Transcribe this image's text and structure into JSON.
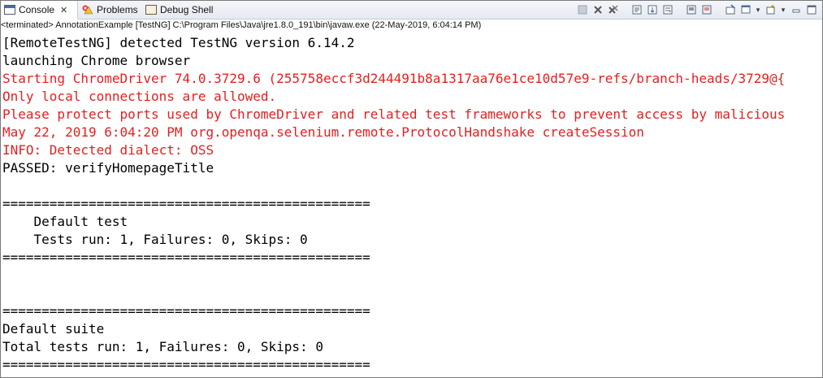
{
  "tabs": [
    {
      "label": "Console",
      "close": "✕"
    },
    {
      "label": "Problems"
    },
    {
      "label": "Debug Shell"
    }
  ],
  "status_line": "<terminated> AnnotationExample [TestNG] C:\\Program Files\\Java\\jre1.8.0_191\\bin\\javaw.exe (22-May-2019, 6:04:14 PM)",
  "console_lines": [
    {
      "text": "[RemoteTestNG] detected TestNG version 6.14.2",
      "color": "black"
    },
    {
      "text": "launching Chrome browser",
      "color": "black"
    },
    {
      "text": "Starting ChromeDriver 74.0.3729.6 (255758eccf3d244491b8a1317aa76e1ce10d57e9-refs/branch-heads/3729@{",
      "color": "red"
    },
    {
      "text": "Only local connections are allowed.",
      "color": "red"
    },
    {
      "text": "Please protect ports used by ChromeDriver and related test frameworks to prevent access by malicious",
      "color": "red"
    },
    {
      "text": "May 22, 2019 6:04:20 PM org.openqa.selenium.remote.ProtocolHandshake createSession",
      "color": "red"
    },
    {
      "text": "INFO: Detected dialect: OSS",
      "color": "red"
    },
    {
      "text": "PASSED: verifyHomepageTitle",
      "color": "black"
    },
    {
      "text": "",
      "color": "black"
    },
    {
      "text": "===============================================",
      "color": "black"
    },
    {
      "text": "    Default test",
      "color": "black"
    },
    {
      "text": "    Tests run: 1, Failures: 0, Skips: 0",
      "color": "black"
    },
    {
      "text": "===============================================",
      "color": "black"
    },
    {
      "text": "",
      "color": "black"
    },
    {
      "text": "",
      "color": "black"
    },
    {
      "text": "===============================================",
      "color": "black"
    },
    {
      "text": "Default suite",
      "color": "black"
    },
    {
      "text": "Total tests run: 1, Failures: 0, Skips: 0",
      "color": "black"
    },
    {
      "text": "===============================================",
      "color": "black"
    }
  ],
  "toolbar_icons": [
    "terminate-icon",
    "remove-launch-icon",
    "remove-all-terminated-icon",
    "clear-console-icon",
    "scroll-lock-icon",
    "word-wrap-icon",
    "show-on-stdout-icon",
    "show-on-stderr-icon",
    "pin-console-icon",
    "display-selected-console-icon",
    "open-console-icon",
    "view-menu-icon"
  ],
  "colors": {
    "stderr": "#e41f1f",
    "stdout": "#000000"
  }
}
